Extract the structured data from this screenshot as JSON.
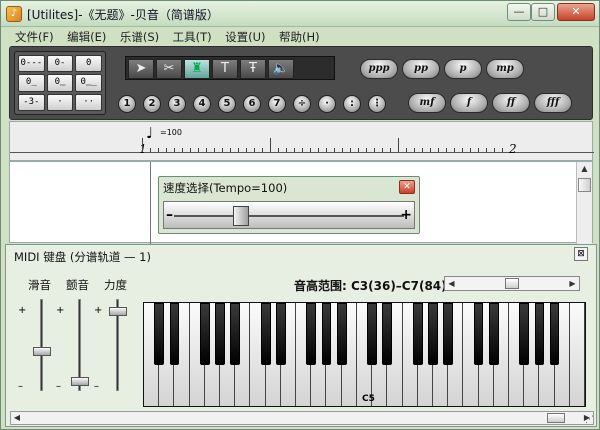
{
  "window": {
    "title": "[Utilites]-《无题》-贝音（简谱版）",
    "app_icon": "music-app-icon",
    "controls": {
      "minimize": "—",
      "maximize": "□",
      "close": "✕"
    }
  },
  "menu": [
    "文件(F)",
    "编辑(E)",
    "乐谱(S)",
    "工具(T)",
    "设置(U)",
    "帮助(H)"
  ],
  "duration_grid": [
    "0---",
    "0-",
    "0",
    "0̲",
    "0̳",
    "0̳̲",
    "-3-",
    "·",
    "··"
  ],
  "tools": [
    {
      "name": "select-arrow-icon",
      "glyph": "➤",
      "active": false
    },
    {
      "name": "scissors-icon",
      "glyph": "✂",
      "active": false
    },
    {
      "name": "metronome-icon",
      "glyph": "♜",
      "active": true
    },
    {
      "name": "text-icon",
      "glyph": "T",
      "active": false
    },
    {
      "name": "lyric-text-icon",
      "glyph": "Ŧ",
      "active": false
    },
    {
      "name": "speaker-icon",
      "glyph": "🔈",
      "active": false
    }
  ],
  "dynamics_row1": [
    "ppp",
    "pp",
    "p",
    "mp"
  ],
  "dynamics_row2": [
    "mf",
    "f",
    "ff",
    "fff"
  ],
  "number_buttons": [
    "1",
    "2",
    "3",
    "4",
    "5",
    "6",
    "7",
    "÷",
    "·",
    ":",
    "⋮"
  ],
  "ruler": {
    "tempo_note": "♩",
    "tempo_text": "=100",
    "measures": [
      "1",
      "2"
    ]
  },
  "tempo_dialog": {
    "title": "速度选择(Tempo=100)",
    "close": "✕",
    "minus": "–",
    "plus": "+",
    "tempo_value": 100,
    "tempo_range": [
      0,
      360
    ]
  },
  "midi_panel": {
    "title": "MIDI 键盘 (分谱轨道 — 1)",
    "close": "⊠",
    "sliders": [
      {
        "label": "滑音",
        "level": 0.42
      },
      {
        "label": "颤音",
        "level": 0.05
      },
      {
        "label": "力度",
        "level": 0.92
      }
    ],
    "plus": "+",
    "minus": "–",
    "range_label": "音高范围:  C3(36)–C7(84)",
    "range_scroll_arrows": [
      "◀",
      "▶"
    ],
    "middle_c_label": "C5",
    "white_keys": 29
  }
}
